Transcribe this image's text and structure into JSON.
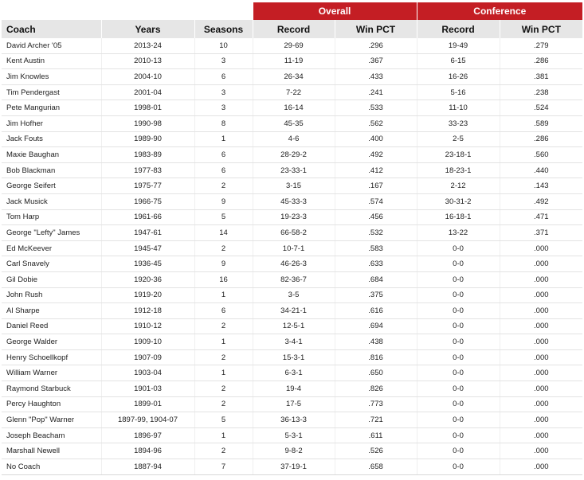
{
  "table": {
    "group_headers": {
      "overall": "Overall",
      "conference": "Conference"
    },
    "columns": [
      "Coach",
      "Years",
      "Seasons",
      "Record",
      "Win PCT",
      "Record",
      "Win PCT"
    ],
    "rows": [
      [
        "David Archer '05",
        "2013-24",
        "10",
        "29-69",
        ".296",
        "19-49",
        ".279"
      ],
      [
        "Kent Austin",
        "2010-13",
        "3",
        "11-19",
        ".367",
        "6-15",
        ".286"
      ],
      [
        "Jim Knowles",
        "2004-10",
        "6",
        "26-34",
        ".433",
        "16-26",
        ".381"
      ],
      [
        "Tim Pendergast",
        "2001-04",
        "3",
        "7-22",
        ".241",
        "5-16",
        ".238"
      ],
      [
        "Pete Mangurian",
        "1998-01",
        "3",
        "16-14",
        ".533",
        "11-10",
        ".524"
      ],
      [
        "Jim Hofher",
        "1990-98",
        "8",
        "45-35",
        ".562",
        "33-23",
        ".589"
      ],
      [
        "Jack Fouts",
        "1989-90",
        "1",
        "4-6",
        ".400",
        "2-5",
        ".286"
      ],
      [
        "Maxie Baughan",
        "1983-89",
        "6",
        "28-29-2",
        ".492",
        "23-18-1",
        ".560"
      ],
      [
        "Bob Blackman",
        "1977-83",
        "6",
        "23-33-1",
        ".412",
        "18-23-1",
        ".440"
      ],
      [
        "George Seifert",
        "1975-77",
        "2",
        "3-15",
        ".167",
        "2-12",
        ".143"
      ],
      [
        "Jack Musick",
        "1966-75",
        "9",
        "45-33-3",
        ".574",
        "30-31-2",
        ".492"
      ],
      [
        "Tom Harp",
        "1961-66",
        "5",
        "19-23-3",
        ".456",
        "16-18-1",
        ".471"
      ],
      [
        "George \"Lefty\" James",
        "1947-61",
        "14",
        "66-58-2",
        ".532",
        "13-22",
        ".371"
      ],
      [
        "Ed McKeever",
        "1945-47",
        "2",
        "10-7-1",
        ".583",
        "0-0",
        ".000"
      ],
      [
        "Carl Snavely",
        "1936-45",
        "9",
        "46-26-3",
        ".633",
        "0-0",
        ".000"
      ],
      [
        "Gil Dobie",
        "1920-36",
        "16",
        "82-36-7",
        ".684",
        "0-0",
        ".000"
      ],
      [
        "John Rush",
        "1919-20",
        "1",
        "3-5",
        ".375",
        "0-0",
        ".000"
      ],
      [
        "Al Sharpe",
        "1912-18",
        "6",
        "34-21-1",
        ".616",
        "0-0",
        ".000"
      ],
      [
        "Daniel Reed",
        "1910-12",
        "2",
        "12-5-1",
        ".694",
        "0-0",
        ".000"
      ],
      [
        "George Walder",
        "1909-10",
        "1",
        "3-4-1",
        ".438",
        "0-0",
        ".000"
      ],
      [
        "Henry Schoellkopf",
        "1907-09",
        "2",
        "15-3-1",
        ".816",
        "0-0",
        ".000"
      ],
      [
        "William Warner",
        "1903-04",
        "1",
        "6-3-1",
        ".650",
        "0-0",
        ".000"
      ],
      [
        "Raymond Starbuck",
        "1901-03",
        "2",
        "19-4",
        ".826",
        "0-0",
        ".000"
      ],
      [
        "Percy Haughton",
        "1899-01",
        "2",
        "17-5",
        ".773",
        "0-0",
        ".000"
      ],
      [
        "Glenn \"Pop\" Warner",
        "1897-99, 1904-07",
        "5",
        "36-13-3",
        ".721",
        "0-0",
        ".000"
      ],
      [
        "Joseph Beacham",
        "1896-97",
        "1",
        "5-3-1",
        ".611",
        "0-0",
        ".000"
      ],
      [
        "Marshall Newell",
        "1894-96",
        "2",
        "9-8-2",
        ".526",
        "0-0",
        ".000"
      ],
      [
        "No Coach",
        "1887-94",
        "7",
        "37-19-1",
        ".658",
        "0-0",
        ".000"
      ]
    ]
  },
  "colors": {
    "header_red": "#c41e24",
    "header_gray": "#e6e6e6"
  }
}
